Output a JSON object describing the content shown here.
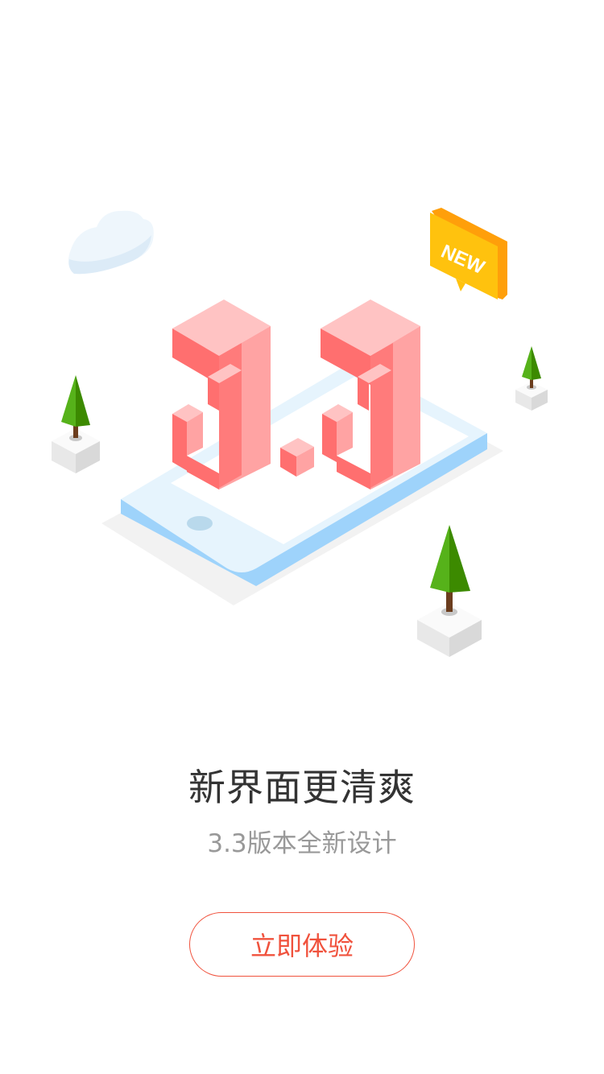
{
  "illustration": {
    "version_number": "3.3",
    "badge_text": "NEW",
    "colors": {
      "digits": "#ff6b6b",
      "phone": "#d5ecfb",
      "tree": "#4e9a06",
      "badge": "#ffc107"
    }
  },
  "intro": {
    "title": "新界面更清爽",
    "subtitle": "3.3版本全新设计"
  },
  "cta": {
    "label": "立即体验",
    "color": "#f0523d"
  }
}
